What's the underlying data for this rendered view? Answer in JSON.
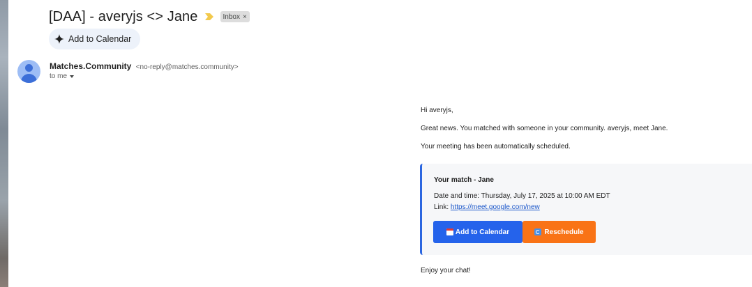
{
  "email": {
    "subject": "[DAA] - averyjs <> Jane",
    "label": "Inbox",
    "label_remove": "×",
    "smart_action": "Add to Calendar",
    "sender_name": "Matches.Community",
    "sender_email": "<no-reply@matches.community>",
    "recipient": "to me"
  },
  "message": {
    "greeting": "Hi averyjs,",
    "line1": "Great news. You matched with someone in your community. averyjs, meet Jane.",
    "line2": "Your meeting has been automatically scheduled.",
    "card": {
      "title": "Your match - Jane",
      "datetime_label": "Date and time:",
      "datetime_value": "Thursday, July 17, 2025 at 10:00 AM EDT",
      "link_label": "Link:",
      "link_url": "https://meet.google.com/new",
      "add_button": "Add to Calendar",
      "reschedule_button": "Reschedule"
    },
    "closing": "Enjoy your chat!"
  },
  "colors": {
    "primary_button": "#2563eb",
    "secondary_button": "#f97316",
    "card_accent": "#2b66e0",
    "importance_marker": "#f2c94c"
  },
  "icons": {
    "importance": "importance-marker-icon",
    "smart_action": "sparkle-icon",
    "add_button": "calendar-emoji-icon",
    "reschedule_button": "repeat-emoji-icon"
  }
}
